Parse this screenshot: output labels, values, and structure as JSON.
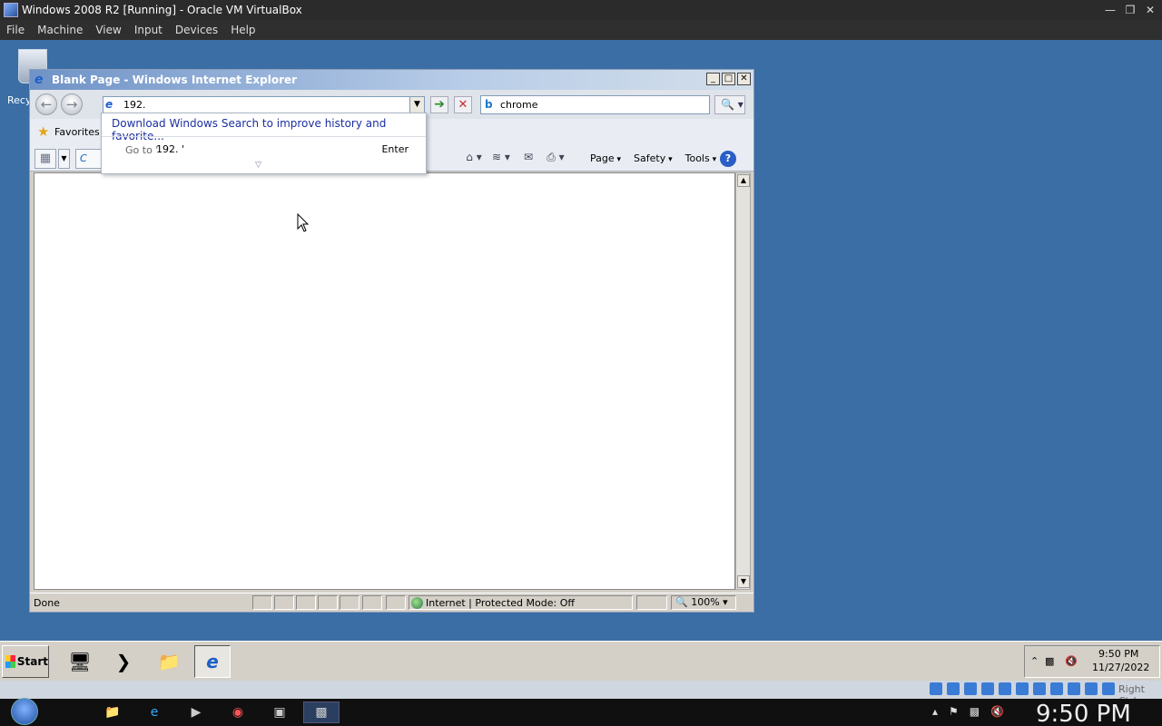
{
  "host": {
    "title": "Windows 2008 R2 [Running] - Oracle VM VirtualBox",
    "menu": [
      "File",
      "Machine",
      "View",
      "Input",
      "Devices",
      "Help"
    ],
    "right_ctrl": "Right Ctrl",
    "clock": "9:50 PM"
  },
  "desktop": {
    "recycle_label": "Recy"
  },
  "ie": {
    "title": "Blank Page - Windows Internet Explorer",
    "address_value": "192.",
    "search_value": "chrome",
    "favorites_label": "Favorites",
    "tab_label": "C",
    "cmd_menus": [
      "Page",
      "Safety",
      "Tools"
    ],
    "status_text": "Done",
    "zone_text": "Internet | Protected Mode: Off",
    "zoom_text": "100%"
  },
  "autocomplete": {
    "download_text": "Download Windows Search to improve history and favorite...",
    "goto_prefix": "Go to '",
    "goto_value": "192. '",
    "enter_label": "Enter"
  },
  "guest_taskbar": {
    "start_label": "Start",
    "time": "9:50 PM",
    "date": "11/27/2022"
  }
}
